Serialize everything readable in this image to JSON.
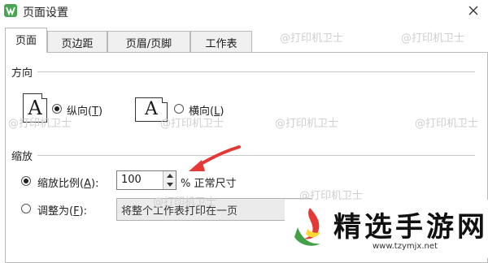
{
  "window": {
    "title": "页面设置",
    "app_icon": "wps-writer-icon",
    "close_icon": "close-icon"
  },
  "tabs": [
    {
      "label": "页面",
      "active": true
    },
    {
      "label": "页边距",
      "active": false
    },
    {
      "label": "页眉/页脚",
      "active": false
    },
    {
      "label": "工作表",
      "active": false
    }
  ],
  "orientation": {
    "section_label": "方向",
    "portrait": {
      "label": "纵向",
      "accel": "T",
      "selected": true,
      "icon_letter": "A"
    },
    "landscape": {
      "label": "横向",
      "accel": "L",
      "selected": false,
      "icon_letter": "A"
    }
  },
  "scaling": {
    "section_label": "缩放",
    "scale": {
      "label": "缩放比例",
      "accel": "A",
      "selected": true,
      "value": "100",
      "unit_note": "% 正常尺寸"
    },
    "fit": {
      "label": "调整为",
      "accel": "F",
      "selected": false,
      "value": "将整个工作表打印在一页"
    }
  },
  "watermark_text": "@打印机卫士",
  "brand": {
    "name": "精选手游网",
    "url": "www.tzymjx.net"
  },
  "colors": {
    "annotation_arrow": "#e53935",
    "app_icon": "#4aa552"
  }
}
